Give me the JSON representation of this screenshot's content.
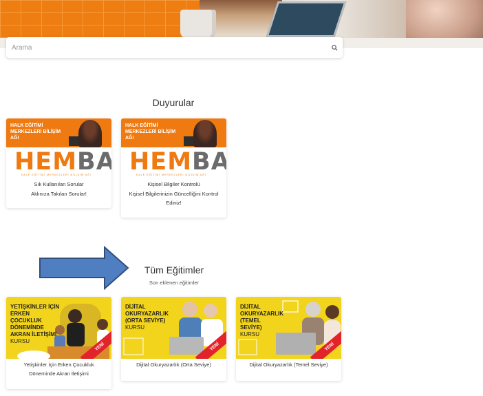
{
  "search": {
    "placeholder": "Arama"
  },
  "announcements": {
    "title": "Duyurular",
    "cards": [
      {
        "image_heading": "HALK EĞİTİMİ MERKEZLERİ BİLİŞİM AĞI",
        "logo": "HEMBA",
        "logo_sub": "HALK EĞİTİMİ MERKEZLERİ BİLİŞİM AĞI",
        "title": "Sık Kullanılan Sorular",
        "desc": "Aklınıza Takılan Sorular!"
      },
      {
        "image_heading": "HALK EĞİTİMİ MERKEZLERİ BİLİŞİM AĞI",
        "logo": "HEMBA",
        "logo_sub": "HALK EĞİTİMİ MERKEZLERİ BİLİŞİM AĞI",
        "title": "Kişisel Bilgiler Kontrolü",
        "desc": "Kişisel Bilgilerinizin Güncelliğini Kontrol Ediniz!"
      }
    ]
  },
  "courses": {
    "title": "Tüm Eğitimler",
    "subtitle": "Son eklenen eğitimler",
    "cards": [
      {
        "image_title": "YETİŞKİNLER İÇİN ERKEN ÇOCUKLUK DÖNEMİNDE AKRAN İLETİŞİMİ",
        "image_sub": "KURSU",
        "badge": "YENİ",
        "title": "Yetişkinler İçin Erken Çocukluk Döneminde Akran İletişimi"
      },
      {
        "image_title": "DİJİTAL OKURYAZARLIK (ORTA SEVİYE)",
        "image_sub": "KURSU",
        "badge": "YENİ",
        "title": "Dijital Okuryazarlık (Orta Seviye)"
      },
      {
        "image_title": "DİJİTAL OKURYAZARLIK (TEMEL SEVİYE)",
        "image_sub": "KURSU",
        "badge": "YENİ",
        "title": "Dijital Okuryazarlık (Temel Seviye)"
      }
    ]
  },
  "colors": {
    "brand_orange": "#f07a12",
    "course_yellow": "#f2d41c",
    "arrow_blue": "#4f7fc0",
    "ribbon_red": "#e3232b"
  }
}
